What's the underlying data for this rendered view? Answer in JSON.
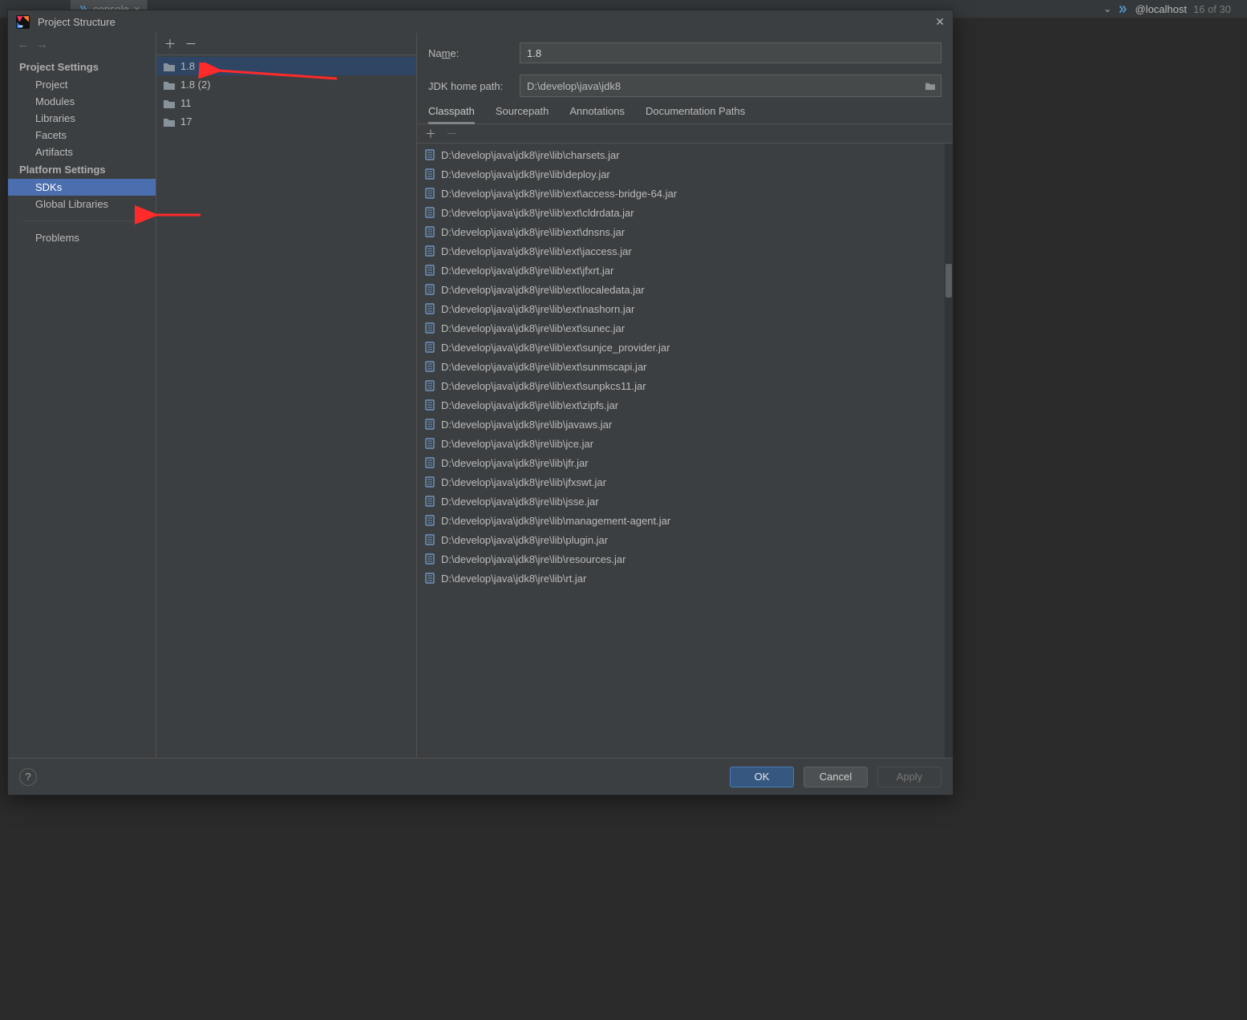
{
  "tabbar": {
    "console_label": "console",
    "right_label": "@localhost",
    "right_count": "16 of 30"
  },
  "dialog": {
    "title": "Project Structure",
    "nav": {
      "project_settings": "Project Settings",
      "items_ps": [
        "Project",
        "Modules",
        "Libraries",
        "Facets",
        "Artifacts"
      ],
      "platform_settings": "Platform Settings",
      "items_pl": [
        "SDKs",
        "Global Libraries"
      ],
      "problems": "Problems",
      "selected": "SDKs"
    },
    "sdklist": {
      "items": [
        "1.8",
        "1.8 (2)",
        "11",
        "17"
      ],
      "selected": "1.8"
    },
    "details": {
      "name_label": "Name:",
      "name_value": "1.8",
      "path_label": "JDK home path:",
      "path_value": "D:\\develop\\java\\jdk8",
      "tabs": [
        "Classpath",
        "Sourcepath",
        "Annotations",
        "Documentation Paths"
      ],
      "selected_tab": "Classpath",
      "classpath": [
        "D:\\develop\\java\\jdk8\\jre\\lib\\charsets.jar",
        "D:\\develop\\java\\jdk8\\jre\\lib\\deploy.jar",
        "D:\\develop\\java\\jdk8\\jre\\lib\\ext\\access-bridge-64.jar",
        "D:\\develop\\java\\jdk8\\jre\\lib\\ext\\cldrdata.jar",
        "D:\\develop\\java\\jdk8\\jre\\lib\\ext\\dnsns.jar",
        "D:\\develop\\java\\jdk8\\jre\\lib\\ext\\jaccess.jar",
        "D:\\develop\\java\\jdk8\\jre\\lib\\ext\\jfxrt.jar",
        "D:\\develop\\java\\jdk8\\jre\\lib\\ext\\localedata.jar",
        "D:\\develop\\java\\jdk8\\jre\\lib\\ext\\nashorn.jar",
        "D:\\develop\\java\\jdk8\\jre\\lib\\ext\\sunec.jar",
        "D:\\develop\\java\\jdk8\\jre\\lib\\ext\\sunjce_provider.jar",
        "D:\\develop\\java\\jdk8\\jre\\lib\\ext\\sunmscapi.jar",
        "D:\\develop\\java\\jdk8\\jre\\lib\\ext\\sunpkcs11.jar",
        "D:\\develop\\java\\jdk8\\jre\\lib\\ext\\zipfs.jar",
        "D:\\develop\\java\\jdk8\\jre\\lib\\javaws.jar",
        "D:\\develop\\java\\jdk8\\jre\\lib\\jce.jar",
        "D:\\develop\\java\\jdk8\\jre\\lib\\jfr.jar",
        "D:\\develop\\java\\jdk8\\jre\\lib\\jfxswt.jar",
        "D:\\develop\\java\\jdk8\\jre\\lib\\jsse.jar",
        "D:\\develop\\java\\jdk8\\jre\\lib\\management-agent.jar",
        "D:\\develop\\java\\jdk8\\jre\\lib\\plugin.jar",
        "D:\\develop\\java\\jdk8\\jre\\lib\\resources.jar",
        "D:\\develop\\java\\jdk8\\jre\\lib\\rt.jar"
      ]
    },
    "footer": {
      "ok": "OK",
      "cancel": "Cancel",
      "apply": "Apply"
    }
  }
}
